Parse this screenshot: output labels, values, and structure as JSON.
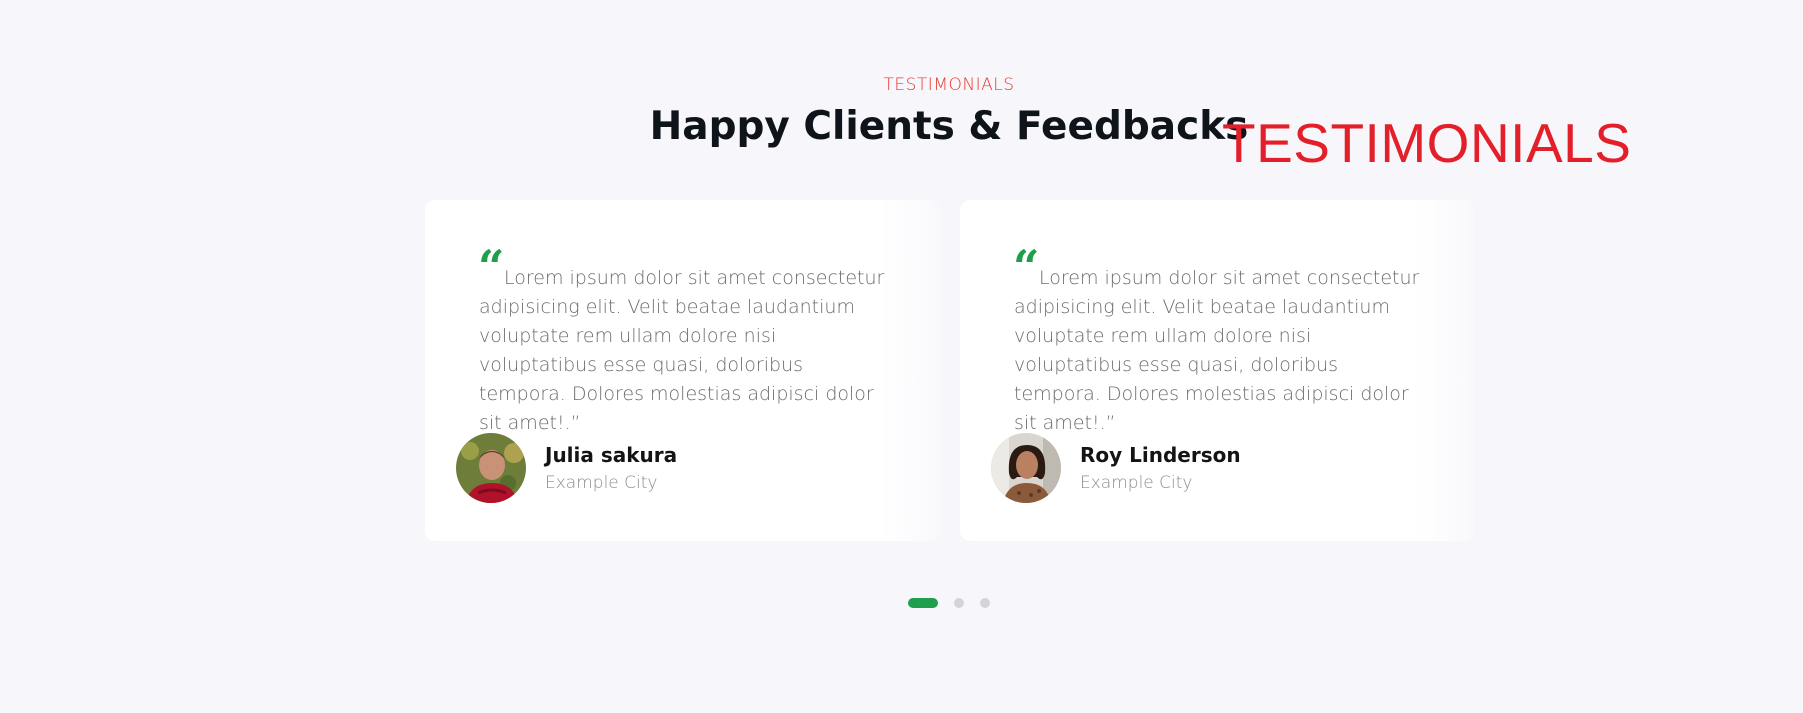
{
  "section": {
    "eyebrow": "TESTIMONIALS",
    "title": "Happy Clients & Feedbacks",
    "overlay_label": "TESTIMONIALS"
  },
  "colors": {
    "accent_red": "#e8392b",
    "overlay_red": "#e3202a",
    "accent_green": "#1f9e4b",
    "background": "#f6f6fb"
  },
  "testimonials": [
    {
      "quote_icon": "quote-open-icon",
      "text": "Lorem ipsum dolor sit amet consectetur adipisicing elit. Velit beatae laudantium voluptate rem ullam dolore nisi voluptatibus esse quasi, doloribus tempora. Dolores molestias adipisci dolor sit amet!.”",
      "name": "Julia sakura",
      "city": "Example City",
      "avatar": "avatar-photo"
    },
    {
      "quote_icon": "quote-open-icon",
      "text": "Lorem ipsum dolor sit amet consectetur adipisicing elit. Velit beatae laudantium voluptate rem ullam dolore nisi voluptatibus esse quasi, doloribus tempora. Dolores molestias adipisci dolor sit amet!.”",
      "name": "Roy Linderson",
      "city": "Example City",
      "avatar": "avatar-photo"
    }
  ],
  "pagination": {
    "count": 3,
    "active_index": 0
  }
}
